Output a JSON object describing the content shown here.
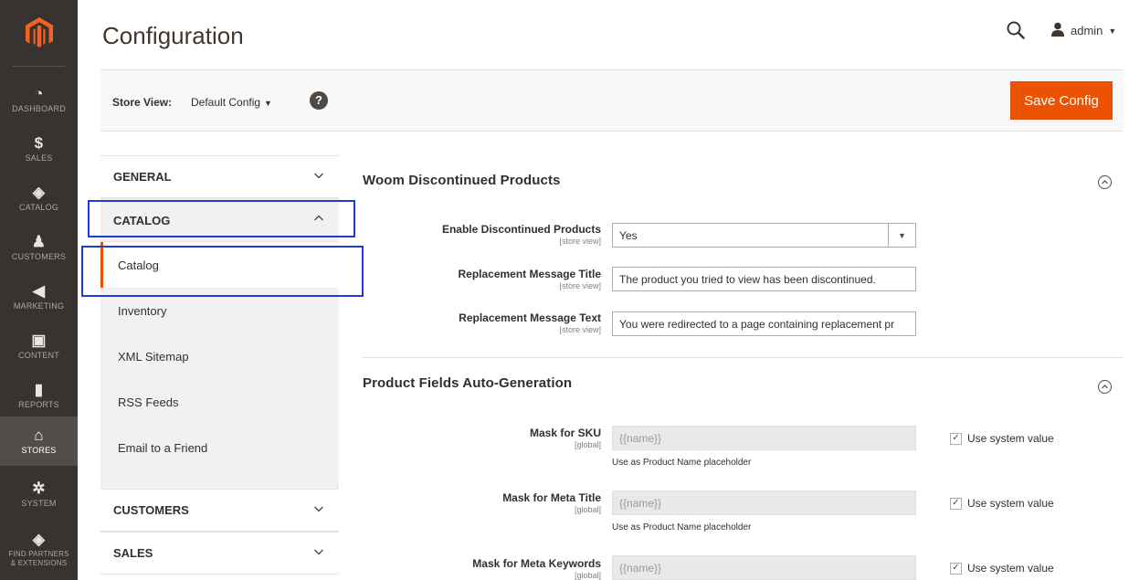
{
  "nav": {
    "items": [
      {
        "label": "DASHBOARD",
        "icon": "dashboard-icon",
        "glyph": "◔"
      },
      {
        "label": "SALES",
        "icon": "dollar-icon",
        "glyph": "$"
      },
      {
        "label": "CATALOG",
        "icon": "box-icon",
        "glyph": "◈"
      },
      {
        "label": "CUSTOMERS",
        "icon": "person-icon",
        "glyph": "♟"
      },
      {
        "label": "MARKETING",
        "icon": "megaphone-icon",
        "glyph": "◀"
      },
      {
        "label": "CONTENT",
        "icon": "layout-icon",
        "glyph": "▣"
      },
      {
        "label": "REPORTS",
        "icon": "bar-chart-icon",
        "glyph": "▮"
      },
      {
        "label": "STORES",
        "icon": "store-icon",
        "glyph": "⌂"
      },
      {
        "label": "SYSTEM",
        "icon": "gear-icon",
        "glyph": "✲"
      },
      {
        "label": "FIND PARTNERS & EXTENSIONS",
        "icon": "puzzle-box-icon",
        "glyph": "◈"
      }
    ],
    "active": "STORES"
  },
  "header": {
    "title": "Configuration",
    "user": "admin"
  },
  "store_bar": {
    "label": "Store View:",
    "value": "Default Config",
    "help": "?",
    "save_label": "Save Config"
  },
  "tabs": {
    "general": "GENERAL",
    "catalog": "CATALOG",
    "customers": "CUSTOMERS",
    "sales": "SALES",
    "catalog_items": [
      "Catalog",
      "Inventory",
      "XML Sitemap",
      "RSS Feeds",
      "Email to a Friend"
    ]
  },
  "sections": {
    "discontinued": {
      "title": "Woom Discontinued Products",
      "enable_label": "Enable Discontinued Products",
      "enable_scope": "[store view]",
      "enable_value": "Yes",
      "msg_title_label": "Replacement Message Title",
      "msg_title_scope": "[store view]",
      "msg_title_value": "The product you tried to view has been discontinued.",
      "msg_text_label": "Replacement Message Text",
      "msg_text_scope": "[store view]",
      "msg_text_value": "You were redirected to a page containing replacement pr"
    },
    "autogen": {
      "title": "Product Fields Auto-Generation",
      "sku_label": "Mask for SKU",
      "sku_scope": "[global]",
      "sku_value": "{{name}}",
      "sku_note": "Use as Product Name placeholder",
      "meta_title_label": "Mask for Meta Title",
      "meta_title_scope": "[global]",
      "meta_title_value": "{{name}}",
      "meta_title_note": "Use as Product Name placeholder",
      "meta_kw_label": "Mask for Meta Keywords",
      "meta_kw_scope": "[global]",
      "meta_kw_value": "{{name}}",
      "use_system": "Use system value"
    }
  },
  "colors": {
    "nav_bg": "#373330",
    "accent": "#eb5202",
    "highlight_outline": "#1f3bd0"
  }
}
